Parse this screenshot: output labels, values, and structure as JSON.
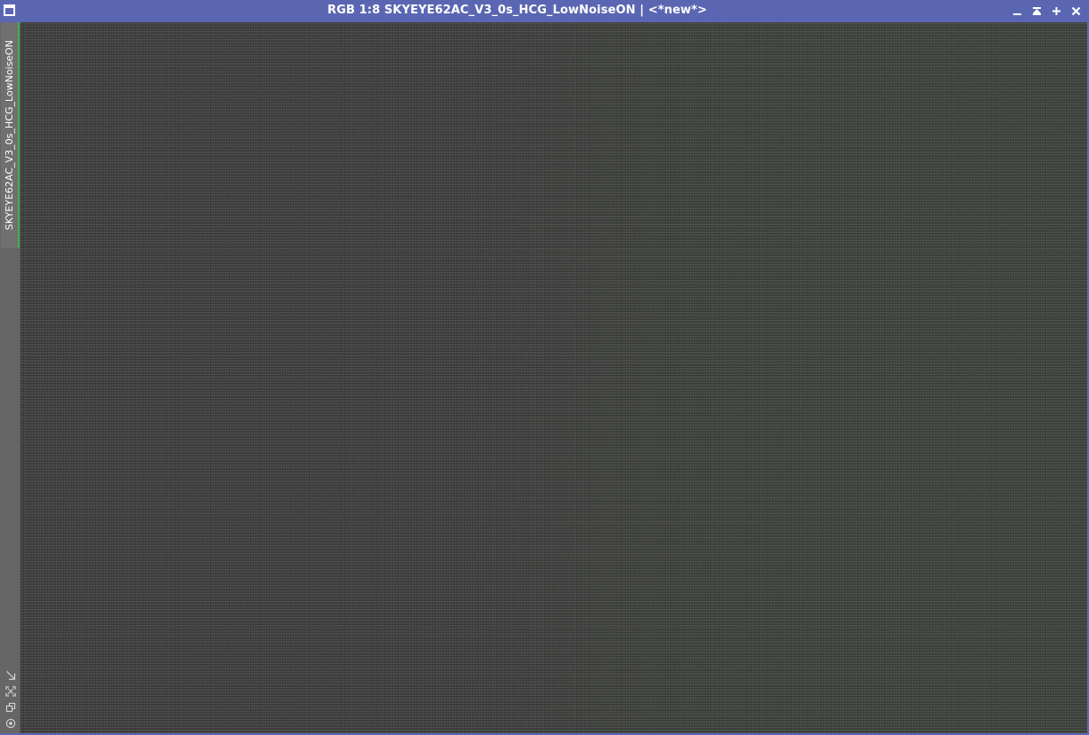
{
  "window": {
    "title": "RGB 1:8 SKYEYE62AC_V3_0s_HCG_LowNoiseON | <*new*>",
    "title_icon": "window-icon",
    "buttons": [
      {
        "name": "minimize",
        "icon": "minimize-icon"
      },
      {
        "name": "shade",
        "icon": "shade-icon"
      },
      {
        "name": "maximize",
        "icon": "maximize-icon"
      },
      {
        "name": "close",
        "icon": "close-icon"
      }
    ],
    "colors": {
      "titlebar": "#5b66b3",
      "tab_accent": "#3fb24f",
      "sidebar": "#666666",
      "image_background": "#3c3d3b"
    }
  },
  "sidebar": {
    "view_tab_label": "SKYEYE62AC_V3_0s_HCG_LowNoiseON",
    "tools": [
      {
        "name": "shrink",
        "icon": "shrink-arrow-icon"
      },
      {
        "name": "fit",
        "icon": "fit-view-icon"
      },
      {
        "name": "clone",
        "icon": "clone-view-icon"
      },
      {
        "name": "preview",
        "icon": "preview-icon"
      }
    ]
  }
}
